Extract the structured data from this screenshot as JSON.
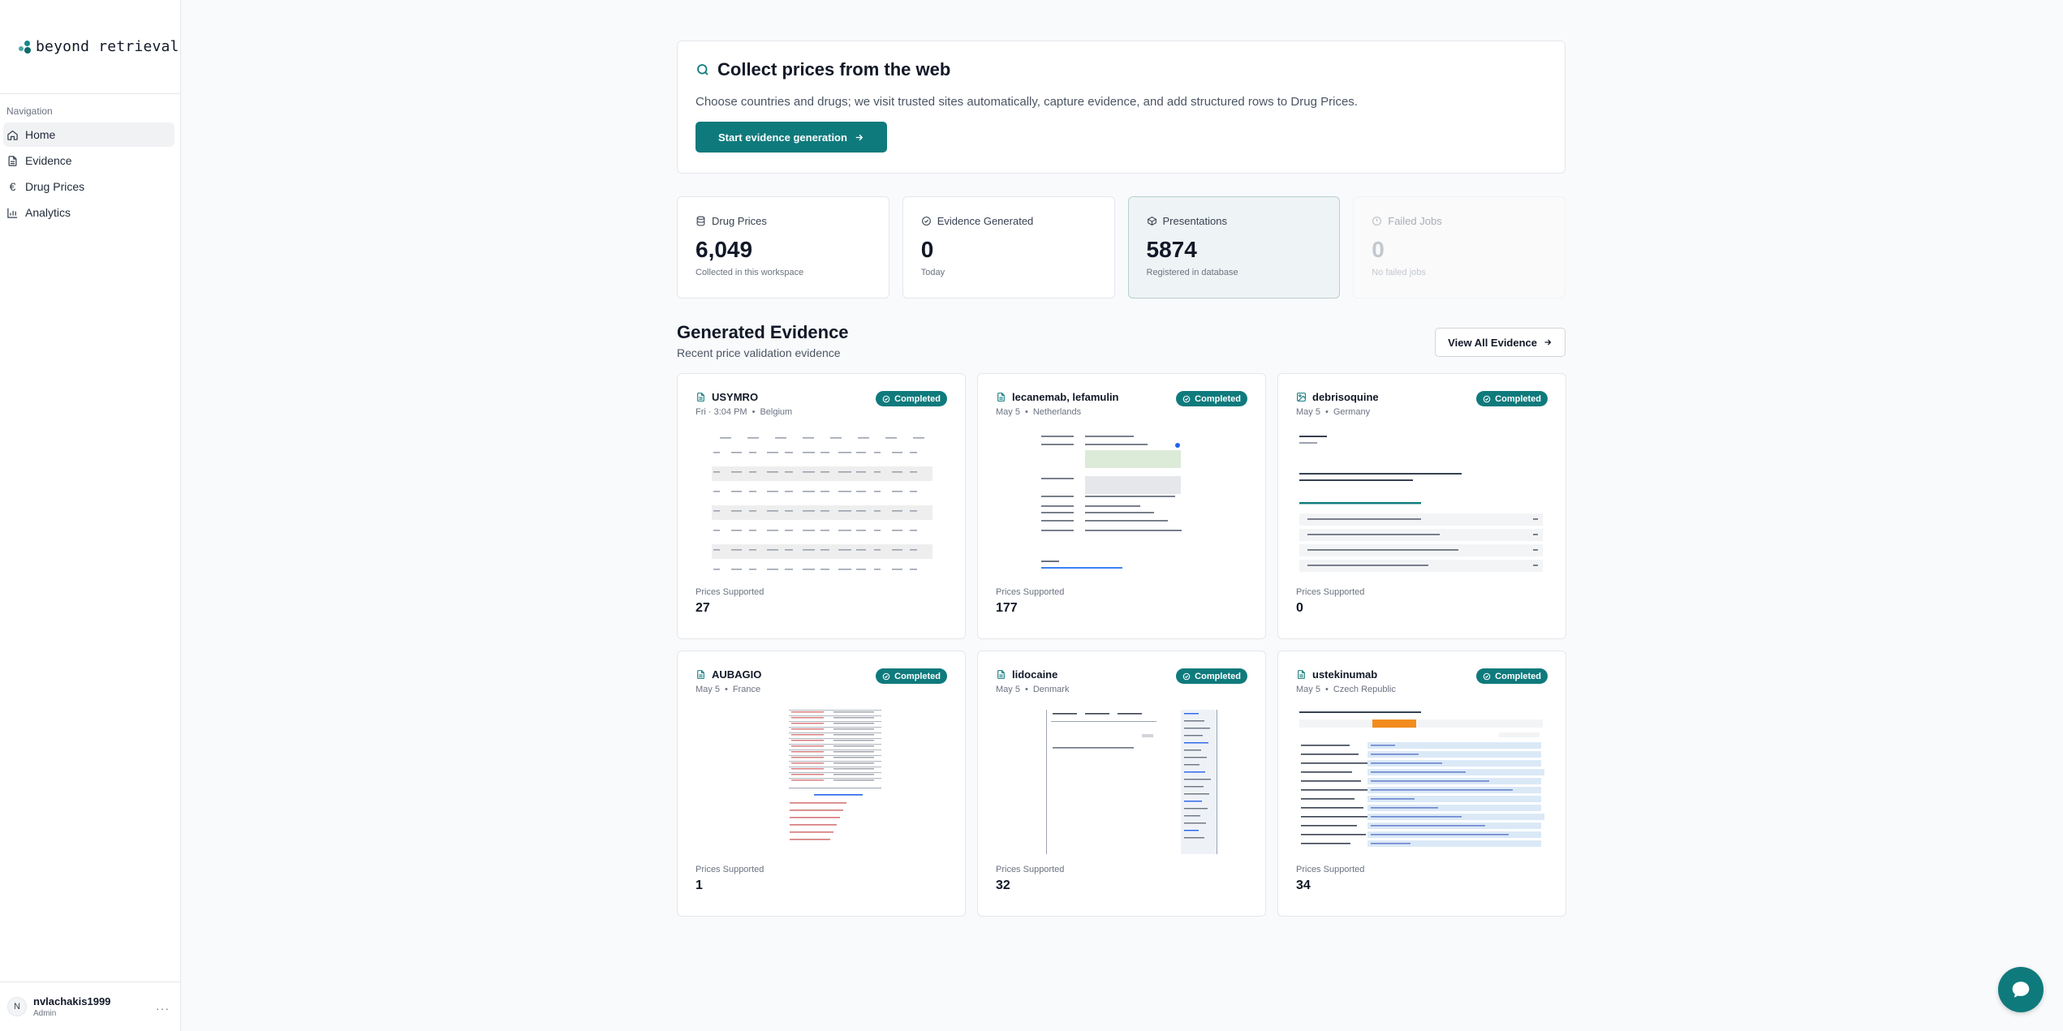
{
  "brand": {
    "name": "beyond retrieval"
  },
  "sidebar": {
    "heading": "Navigation",
    "items": [
      {
        "label": "Home",
        "icon": "home-icon",
        "active": true
      },
      {
        "label": "Evidence",
        "icon": "file-icon",
        "active": false
      },
      {
        "label": "Drug Prices",
        "icon": "euro-icon",
        "active": false
      },
      {
        "label": "Analytics",
        "icon": "bar-chart-icon",
        "active": false
      }
    ],
    "user": {
      "initial": "N",
      "name": "nvlachakis1999",
      "role": "Admin",
      "more": "···"
    }
  },
  "hero": {
    "title": "Collect prices from the web",
    "description": "Choose countries and drugs; we visit trusted sites automatically, capture evidence, and add structured rows to Drug Prices.",
    "button": "Start evidence generation"
  },
  "stats": [
    {
      "label": "Drug Prices",
      "value": "6,049",
      "sub": "Collected in this workspace"
    },
    {
      "label": "Evidence Generated",
      "value": "0",
      "sub": "Today"
    },
    {
      "label": "Presentations",
      "value": "5874",
      "sub": "Registered in database"
    },
    {
      "label": "Failed Jobs",
      "value": "0",
      "sub": "No failed jobs"
    }
  ],
  "evidence": {
    "title": "Generated Evidence",
    "subtitle": "Recent price validation evidence",
    "view_all": "View All Evidence",
    "prices_label": "Prices Supported",
    "badge": "Completed",
    "separator": "•",
    "cards": [
      {
        "title": "USYMRO",
        "date": "Fri · 3:04 PM",
        "country": "Belgium",
        "prices": "27",
        "icon": "file-icon",
        "thumb": "table"
      },
      {
        "title": "lecanemab, lefamulin",
        "date": "May 5",
        "country": "Netherlands",
        "prices": "177",
        "icon": "file-icon",
        "thumb": "form"
      },
      {
        "title": "debrisoquine",
        "date": "May 5",
        "country": "Germany",
        "prices": "0",
        "icon": "image-icon",
        "thumb": "accordion"
      },
      {
        "title": "AUBAGIO",
        "date": "May 5",
        "country": "France",
        "prices": "1",
        "icon": "file-icon",
        "thumb": "redtable"
      },
      {
        "title": "lidocaine",
        "date": "May 5",
        "country": "Denmark",
        "prices": "32",
        "icon": "file-icon",
        "thumb": "split"
      },
      {
        "title": "ustekinumab",
        "date": "May 5",
        "country": "Czech Republic",
        "prices": "34",
        "icon": "file-icon",
        "thumb": "bluetable"
      }
    ]
  },
  "colors": {
    "accent": "#0f7a7c",
    "highlight_bg": "#eef4f5"
  }
}
